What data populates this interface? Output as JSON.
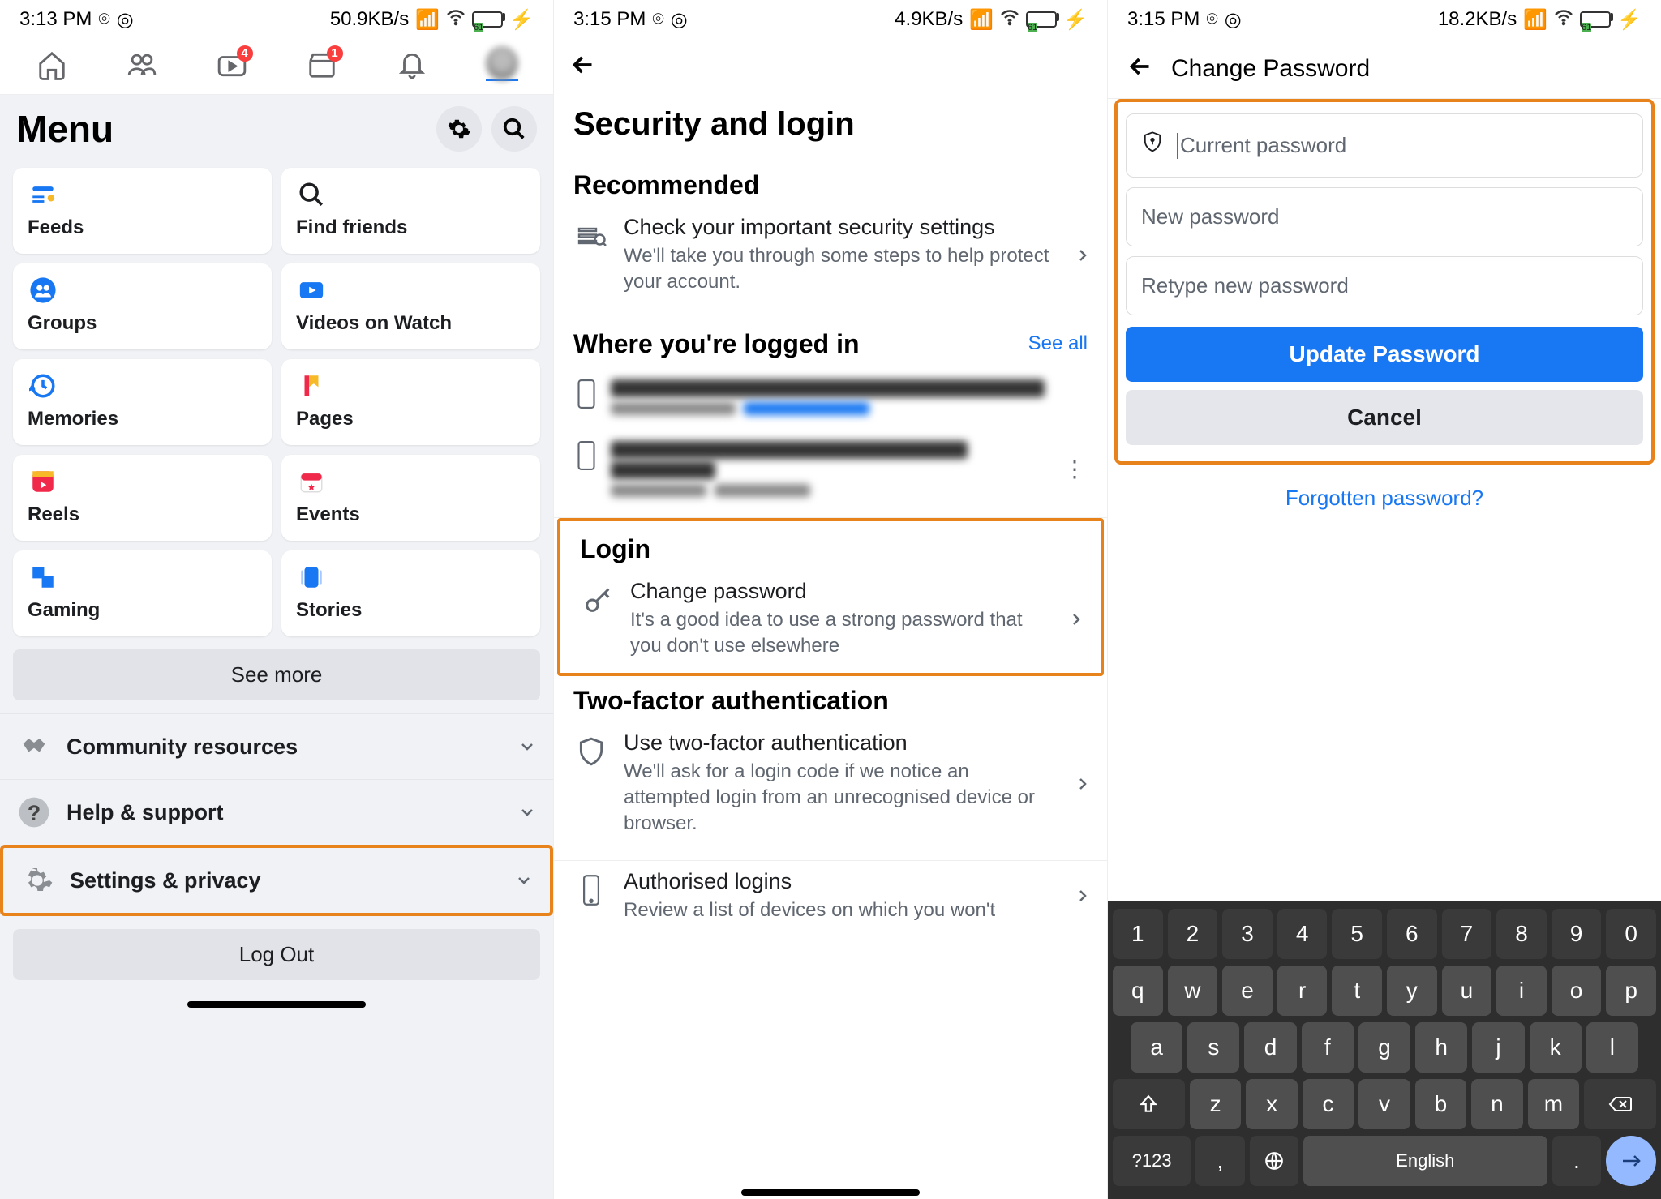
{
  "pane1": {
    "status": {
      "time": "3:13 PM",
      "net": "50.9KB/s"
    },
    "battery": "61",
    "nav_badges": {
      "video": "4",
      "marketplace": "1"
    },
    "title": "Menu",
    "tiles": {
      "feeds": "Feeds",
      "find_friends": "Find friends",
      "groups": "Groups",
      "videos": "Videos on Watch",
      "memories": "Memories",
      "pages": "Pages",
      "reels": "Reels",
      "events": "Events",
      "gaming": "Gaming",
      "stories": "Stories"
    },
    "see_more": "See more",
    "expand": {
      "community": "Community resources",
      "help": "Help & support",
      "settings": "Settings & privacy"
    },
    "logout": "Log Out"
  },
  "pane2": {
    "status": {
      "time": "3:15 PM",
      "net": "4.9KB/s"
    },
    "battery": "61",
    "title": "Security and login",
    "recommended": "Recommended",
    "rec_row": {
      "title": "Check your important security settings",
      "sub": "We'll take you through some steps to help protect your account."
    },
    "where_title": "Where you're logged in",
    "see_all": "See all",
    "login_title": "Login",
    "change_pw": {
      "title": "Change password",
      "sub": "It's a good idea to use a strong password that you don't use elsewhere"
    },
    "tfa_title": "Two-factor authentication",
    "tfa_row": {
      "title": "Use two-factor authentication",
      "sub": "We'll ask for a login code if we notice an attempted login from an unrecognised device or browser."
    },
    "auth_row": {
      "title": "Authorised logins",
      "sub": "Review a list of devices on which you won't"
    }
  },
  "pane3": {
    "status": {
      "time": "3:15 PM",
      "net": "18.2KB/s"
    },
    "battery": "61",
    "header": "Change Password",
    "placeholders": {
      "current": "Current password",
      "new": "New password",
      "retype": "Retype new password"
    },
    "update_btn": "Update Password",
    "cancel_btn": "Cancel",
    "forgot": "Forgotten password?",
    "keyboard": {
      "row_num": [
        "1",
        "2",
        "3",
        "4",
        "5",
        "6",
        "7",
        "8",
        "9",
        "0"
      ],
      "row1": [
        "q",
        "w",
        "e",
        "r",
        "t",
        "y",
        "u",
        "i",
        "o",
        "p"
      ],
      "row2": [
        "a",
        "s",
        "d",
        "f",
        "g",
        "h",
        "j",
        "k",
        "l"
      ],
      "row3": [
        "z",
        "x",
        "c",
        "v",
        "b",
        "n",
        "m"
      ],
      "symkey": "?123",
      "comma": ",",
      "period": ".",
      "space_label": "English"
    }
  }
}
